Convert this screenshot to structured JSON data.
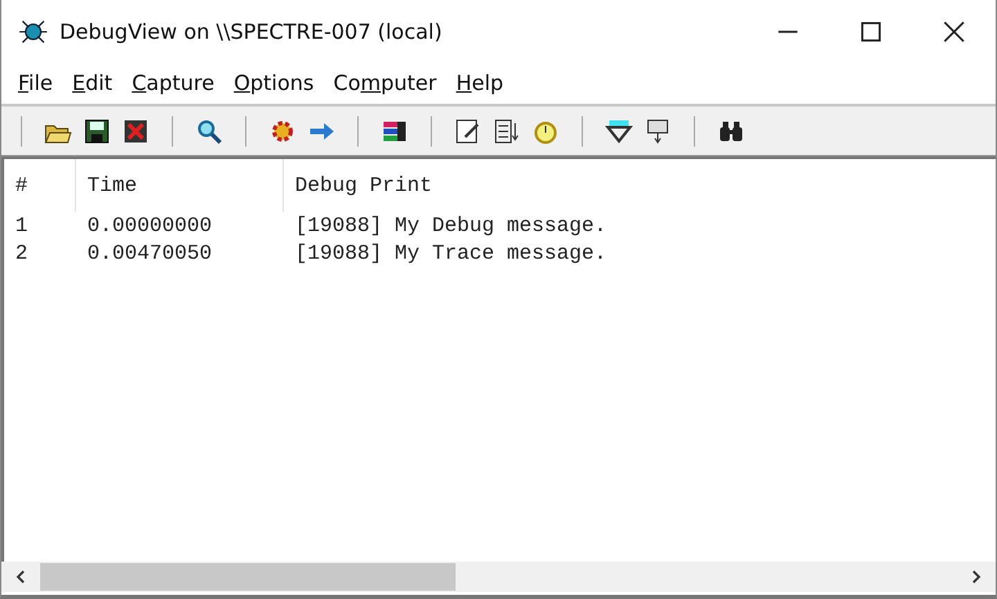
{
  "window": {
    "title": "DebugView on \\\\SPECTRE-007 (local)"
  },
  "menu": [
    {
      "key": "F",
      "post": "ile"
    },
    {
      "key": "E",
      "post": "dit"
    },
    {
      "key": "C",
      "post": "apture"
    },
    {
      "key": "O",
      "post": "ptions"
    },
    {
      "pre": "Co",
      "key": "m",
      "post": "puter"
    },
    {
      "key": "H",
      "post": "elp"
    }
  ],
  "table": {
    "columns": [
      "#",
      "Time",
      "Debug Print"
    ],
    "rows": [
      [
        "1",
        "0.00000000",
        "[19088] My Debug message."
      ],
      [
        "2",
        "0.00470050",
        "[19088] My Trace message."
      ]
    ]
  }
}
